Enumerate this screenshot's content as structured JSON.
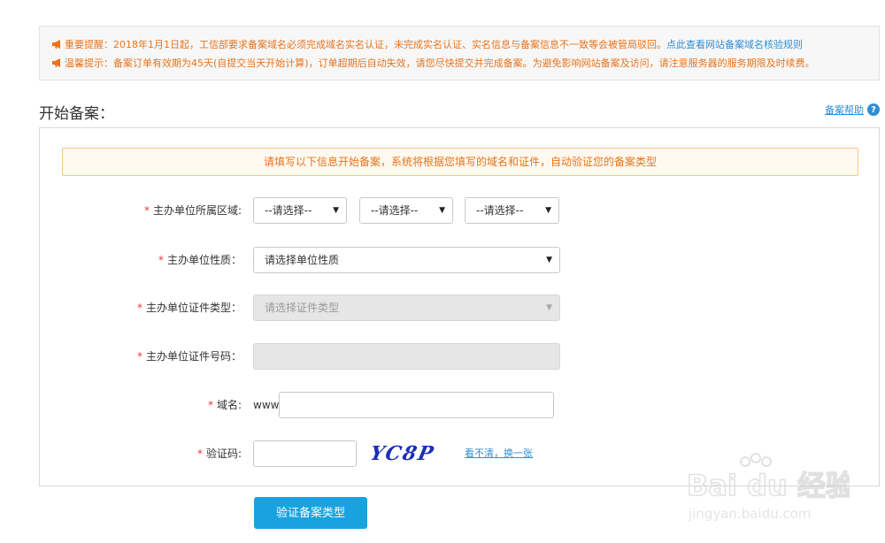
{
  "notice": {
    "line1_text": "重要提醒：2018年1月1日起，工信部要求备案域名必须完成域名实名认证，未完成实名认证、实名信息与备案信息不一致等会被管局驳回。",
    "line1_link": "点此查看网站备案域名核验规则",
    "line2_text": "温馨提示：备案订单有效期为45天(自提交当天开始计算)，订单超期后自动失效，请您尽快提交并完成备案。为避免影响网站备案及访问，请注意服务器的服务期限及时续费。"
  },
  "page": {
    "title": "开始备案：",
    "help_label": "备案帮助",
    "help_icon": "question-icon"
  },
  "form": {
    "tip": "请填写以下信息开始备案，系统将根据您填写的域名和证件，自动验证您的备案类型",
    "required_mark": "*",
    "region": {
      "label": "主办单位所属区域:",
      "province": "--请选择--",
      "city": "--请选择--",
      "district": "--请选择--"
    },
    "org_nature": {
      "label": "主办单位性质：",
      "value": "请选择单位性质"
    },
    "cert_type": {
      "label": "主办单位证件类型：",
      "value": "请选择证件类型"
    },
    "cert_number": {
      "label": "主办单位证件号码："
    },
    "domain": {
      "label": "域名:",
      "prefix": "www."
    },
    "captcha": {
      "label": "验证码:",
      "image_text": "YC8P",
      "refresh_label": "看不清，换一张"
    },
    "submit_label": "验证备案类型"
  },
  "watermark": {
    "logo_text": "Bai du 经验",
    "url": "jingyan.baidu.com"
  },
  "colors": {
    "accent": "#1aa2e0",
    "warning": "#e8741c",
    "link": "#2f8ed4",
    "required": "#e4393c"
  }
}
